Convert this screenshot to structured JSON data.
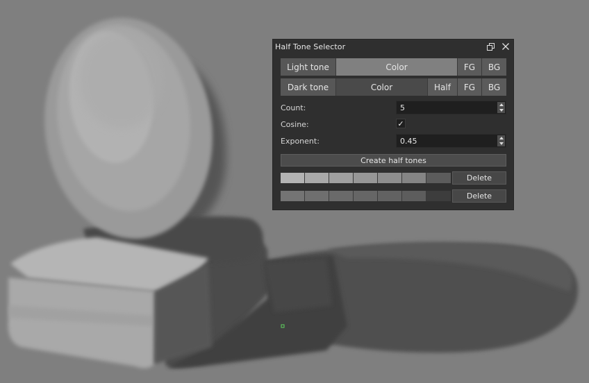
{
  "dialog": {
    "title": "Half Tone Selector",
    "float_icon": "float-window-icon",
    "close_icon": "close-icon"
  },
  "light_tone": {
    "label": "Light tone",
    "color_label": "Color",
    "fg_label": "FG",
    "bg_label": "BG",
    "color_hex": "#808080"
  },
  "dark_tone": {
    "label": "Dark tone",
    "color_label": "Color",
    "half_label": "Half",
    "fg_label": "FG",
    "bg_label": "BG",
    "color_hex": "#4a4a4a"
  },
  "count": {
    "label": "Count:",
    "value": "5"
  },
  "cosine": {
    "label": "Cosine:",
    "checked": true,
    "mark": "✓"
  },
  "exponent": {
    "label": "Exponent:",
    "value": "0.45"
  },
  "create_button": "Create half tones",
  "palettes": [
    {
      "colors": [
        "#b3b3b3",
        "#a9a9a9",
        "#a0a0a0",
        "#979797",
        "#8e8e8e",
        "#858585",
        "#5c5c5c"
      ],
      "delete_label": "Delete"
    },
    {
      "colors": [
        "#747474",
        "#6f6f6f",
        "#6a6a6a",
        "#666666",
        "#626262",
        "#5d5d5d",
        "#3d3d3d"
      ],
      "delete_label": "Delete"
    }
  ],
  "canvas": {
    "background_color": "#7f7f7f"
  }
}
